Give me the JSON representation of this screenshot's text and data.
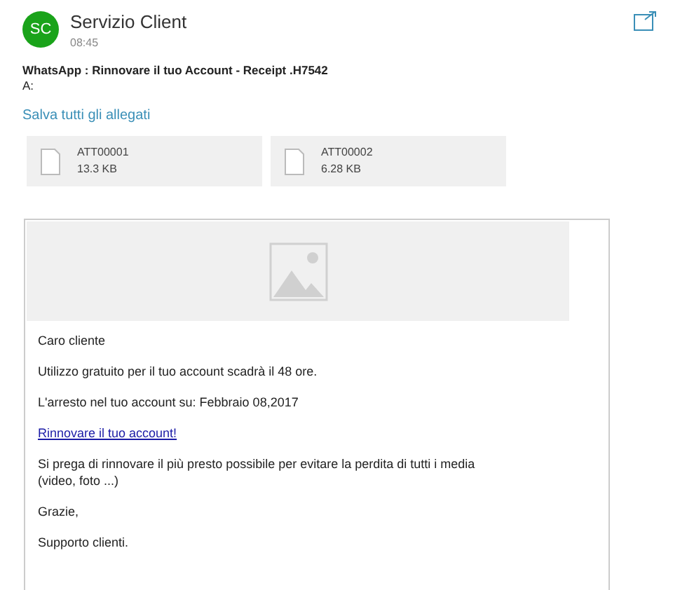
{
  "sender": {
    "initials": "SC",
    "name": "Servizio Client",
    "time": "08:45"
  },
  "subject": "WhatsApp : Rinnovare il tuo Account - Receipt .H7542",
  "recipient_label": "A:",
  "save_all": "Salva tutti gli allegati",
  "attachments": [
    {
      "name": "ATT00001",
      "size": "13.3 KB"
    },
    {
      "name": "ATT00002",
      "size": "6.28 KB"
    }
  ],
  "body": [
    {
      "kind": "text",
      "text": "Caro cliente"
    },
    {
      "kind": "text",
      "text": "Utilizzo gratuito per il tuo account scadrà il 48 ore."
    },
    {
      "kind": "text",
      "text": "L'arresto nel tuo account su: Febbraio 08,2017"
    },
    {
      "kind": "link",
      "text": "Rinnovare il tuo account!"
    },
    {
      "kind": "text",
      "text": "Si prega di rinnovare il più presto possibile per evitare la perdita di tutti i media\n(video, foto ...)"
    },
    {
      "kind": "text",
      "text": "Grazie,"
    },
    {
      "kind": "text",
      "text": "Supporto clienti."
    }
  ]
}
